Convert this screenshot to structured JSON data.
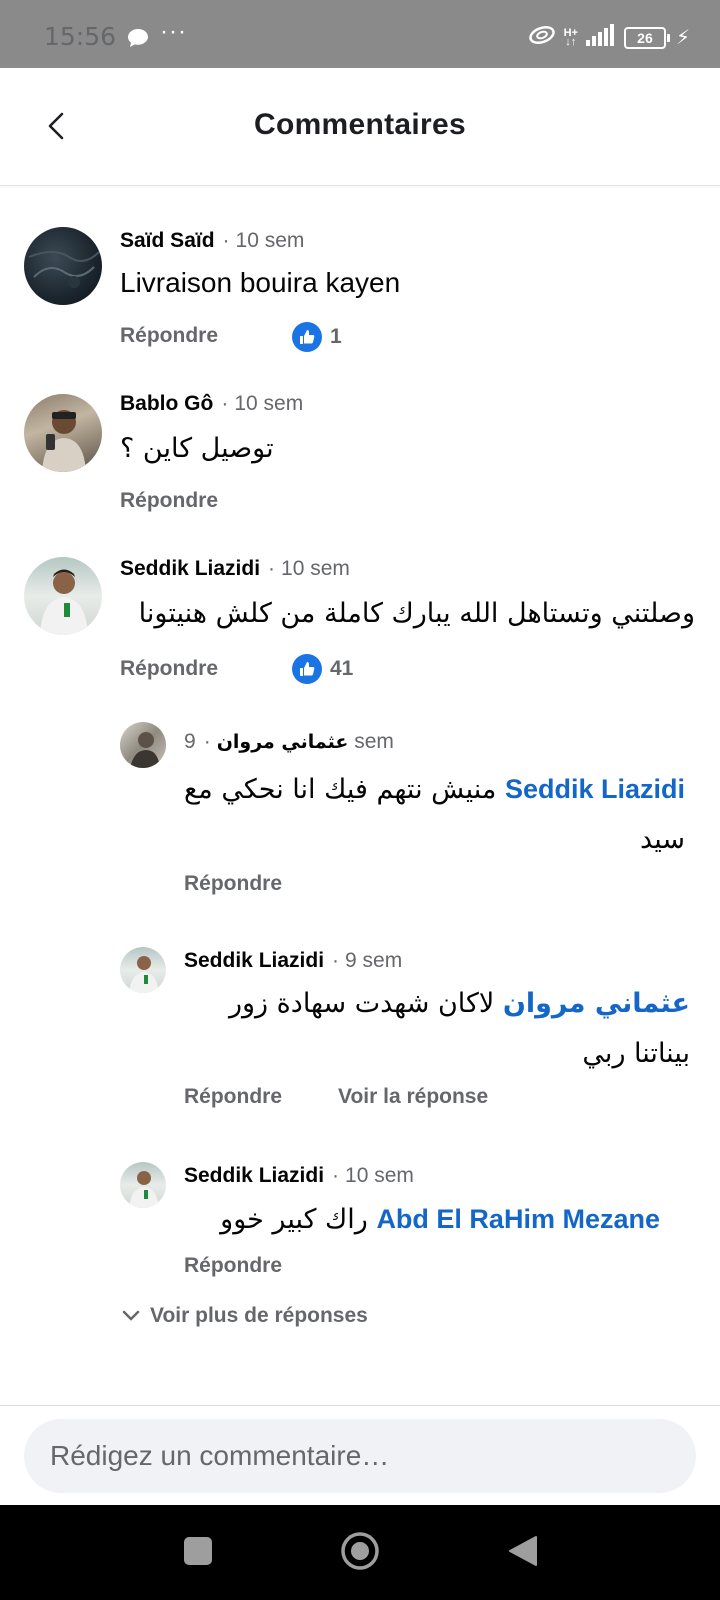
{
  "status_bar": {
    "time": "15:56",
    "more": "···",
    "network": "H+",
    "battery": "26"
  },
  "header": {
    "title": "Commentaires"
  },
  "comments": [
    {
      "author": "Saïd Saïd",
      "time": "10 sem",
      "text": "Livraison bouira kayen",
      "reply_label": "Répondre",
      "reactions": "1"
    },
    {
      "author": "Bablo Gô",
      "time": "10 sem",
      "text": "توصيل كاين ؟",
      "reply_label": "Répondre"
    },
    {
      "author": "Seddik Liazidi",
      "time": "10 sem",
      "text": "وصلتني وتستاهل الله يبارك كاملة من كلش هنيتونا",
      "reply_label": "Répondre",
      "reactions": "41"
    }
  ],
  "replies": [
    {
      "author": "عثماني مروان",
      "time": "9 sem",
      "mention": "Seddik Liazidi",
      "text": "منيش نتهم فيك انا نحكي مع سيد",
      "reply_label": "Répondre"
    },
    {
      "author": "Seddik Liazidi",
      "time": "9 sem",
      "mention": "عثماني مروان",
      "text": "لاكان شهدت سهادة زور بيناتنا ربي",
      "reply_label": "Répondre",
      "view_reply_label": "Voir la réponse"
    },
    {
      "author": "Seddik Liazidi",
      "time": "10 sem",
      "mention": "Abd El RaHim Mezane",
      "text": "راك كبير خوو",
      "reply_label": "Répondre"
    }
  ],
  "more_replies_label": "Voir plus de réponses",
  "composer": {
    "placeholder": "Rédigez un commentaire…"
  },
  "colors": {
    "mention": "#1467c9",
    "like": "#1b74e4",
    "meta": "#65676b"
  }
}
